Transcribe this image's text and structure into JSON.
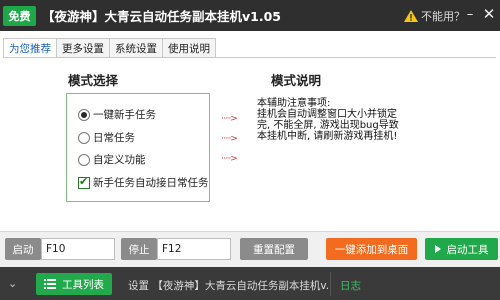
{
  "titlebar": {
    "badge": "免费",
    "title": "【夜游神】大青云自动任务副本挂机v1.05",
    "not_working": "不能用？",
    "minimize": "–",
    "close": "✕"
  },
  "tabs": [
    {
      "label": "为您推荐",
      "active": true
    },
    {
      "label": "更多设置",
      "active": false
    },
    {
      "label": "系统设置",
      "active": false
    },
    {
      "label": "使用说明",
      "active": false
    }
  ],
  "mode_select": {
    "title": "模式选择",
    "options": [
      {
        "label": "一键新手任务",
        "type": "radio",
        "checked": true
      },
      {
        "label": "日常任务",
        "type": "radio",
        "checked": false
      },
      {
        "label": "自定义功能",
        "type": "radio",
        "checked": false
      },
      {
        "label": "新手任务自动接日常任务",
        "type": "checkbox",
        "checked": true
      }
    ],
    "arrows": [
      "·····>",
      "·····>",
      "·····>"
    ]
  },
  "mode_explain": {
    "title": "模式说明",
    "lines": [
      "本辅助注意事项:",
      "挂机会自动调整窗口大小并锁定",
      "完, 不能全屏, 游戏出现bug导致",
      "本挂机中断, 请刷新游戏再挂机!"
    ]
  },
  "controls": {
    "start_label": "启动",
    "start_hotkey": "F10",
    "stop_label": "停止",
    "stop_hotkey": "F12",
    "reset_button": "重置配置",
    "add_desktop_button": "一键添加到桌面",
    "start_tool_button": "启动工具"
  },
  "statusbar": {
    "chevron": "⌄",
    "tool_list_button": "工具列表",
    "status_text": "设置 【夜游神】大青云自动任务副本挂机v...",
    "log_link": "日志"
  },
  "colors": {
    "green": "#20a94a",
    "orange": "#f26b1f",
    "titlebar": "#2f2f2f"
  }
}
